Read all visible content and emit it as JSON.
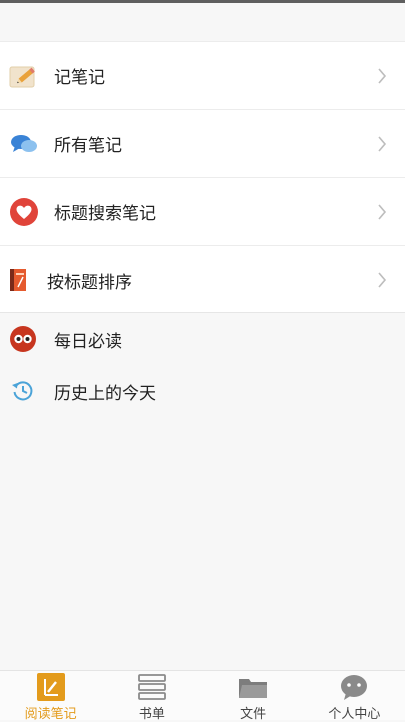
{
  "menu": {
    "items": [
      {
        "label": "记笔记",
        "icon": "pencil-note-icon"
      },
      {
        "label": "所有笔记",
        "icon": "chat-bubbles-icon"
      },
      {
        "label": "标题搜索笔记",
        "icon": "heart-icon"
      },
      {
        "label": "按标题排序",
        "icon": "book-icon"
      }
    ]
  },
  "extra": {
    "daily_label": "每日必读",
    "daily_icon": "owl-eyes-icon",
    "history_label": "历史上的今天",
    "history_icon": "history-clock-icon"
  },
  "tabbar": {
    "tabs": [
      {
        "label": "阅读笔记",
        "icon": "pen-note-icon",
        "active": true
      },
      {
        "label": "书单",
        "icon": "book-stack-icon",
        "active": false
      },
      {
        "label": "文件",
        "icon": "folder-icon",
        "active": false
      },
      {
        "label": "个人中心",
        "icon": "chat-face-icon",
        "active": false
      }
    ]
  },
  "colors": {
    "accent": "#e39b1c",
    "tab_inactive_icon": "#8a8a8a",
    "heart_red": "#e0443a",
    "bubble_blue": "#3a83d6",
    "history_blue": "#4aa3d8"
  }
}
